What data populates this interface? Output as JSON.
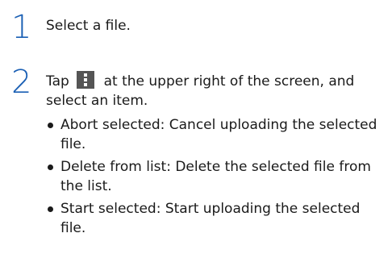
{
  "steps": [
    {
      "number": "1",
      "text": "Select a file."
    },
    {
      "number": "2",
      "text_before_icon": "Tap",
      "icon": "more-vert-icon",
      "text_after_icon": "at the upper right of the screen, and select an item.",
      "items": [
        {
          "text": "Abort selected: Cancel uploading the selected file."
        },
        {
          "text": "Delete from list: Delete the selected file from the list."
        },
        {
          "text": "Start selected: Start uploading the selected file."
        }
      ]
    }
  ]
}
